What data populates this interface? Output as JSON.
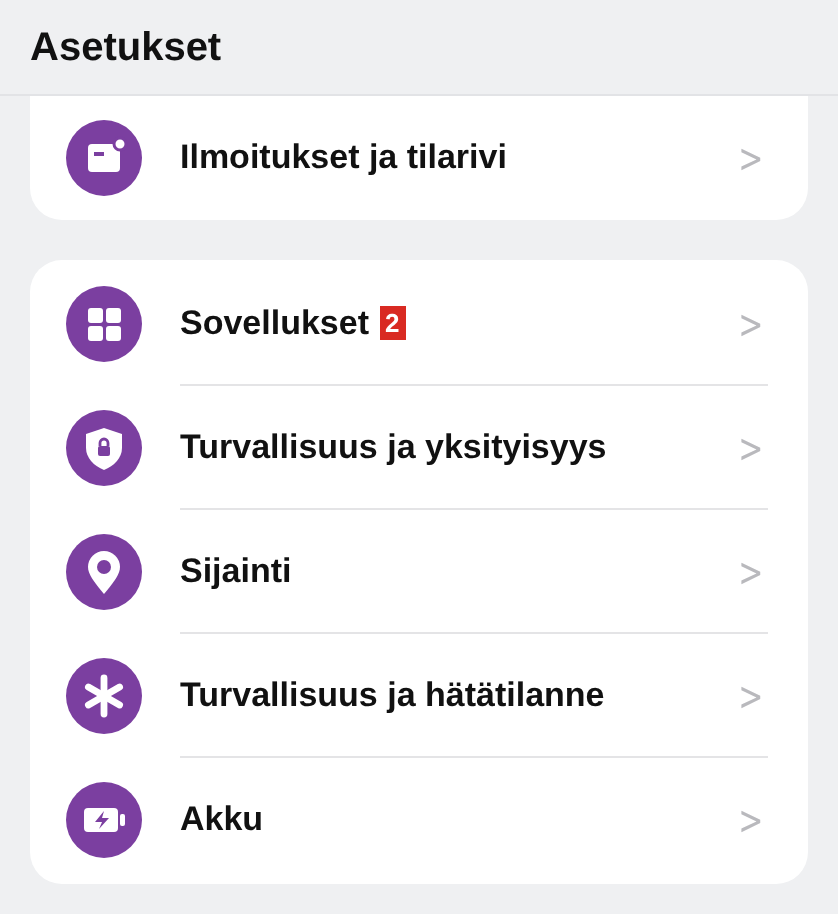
{
  "header": {
    "title": "Asetukset"
  },
  "groups": [
    {
      "items": [
        {
          "label": "Ilmoitukset ja tilarivi",
          "chevron": ">"
        }
      ]
    },
    {
      "items": [
        {
          "label": "Sovellukset",
          "badge": "2",
          "chevron": ">"
        },
        {
          "label": "Turvallisuus ja yksityisyys",
          "chevron": ">"
        },
        {
          "label": "Sijainti",
          "chevron": ">"
        },
        {
          "label": "Turvallisuus ja hätätilanne",
          "chevron": ">"
        },
        {
          "label": "Akku",
          "chevron": ">"
        }
      ]
    }
  ]
}
